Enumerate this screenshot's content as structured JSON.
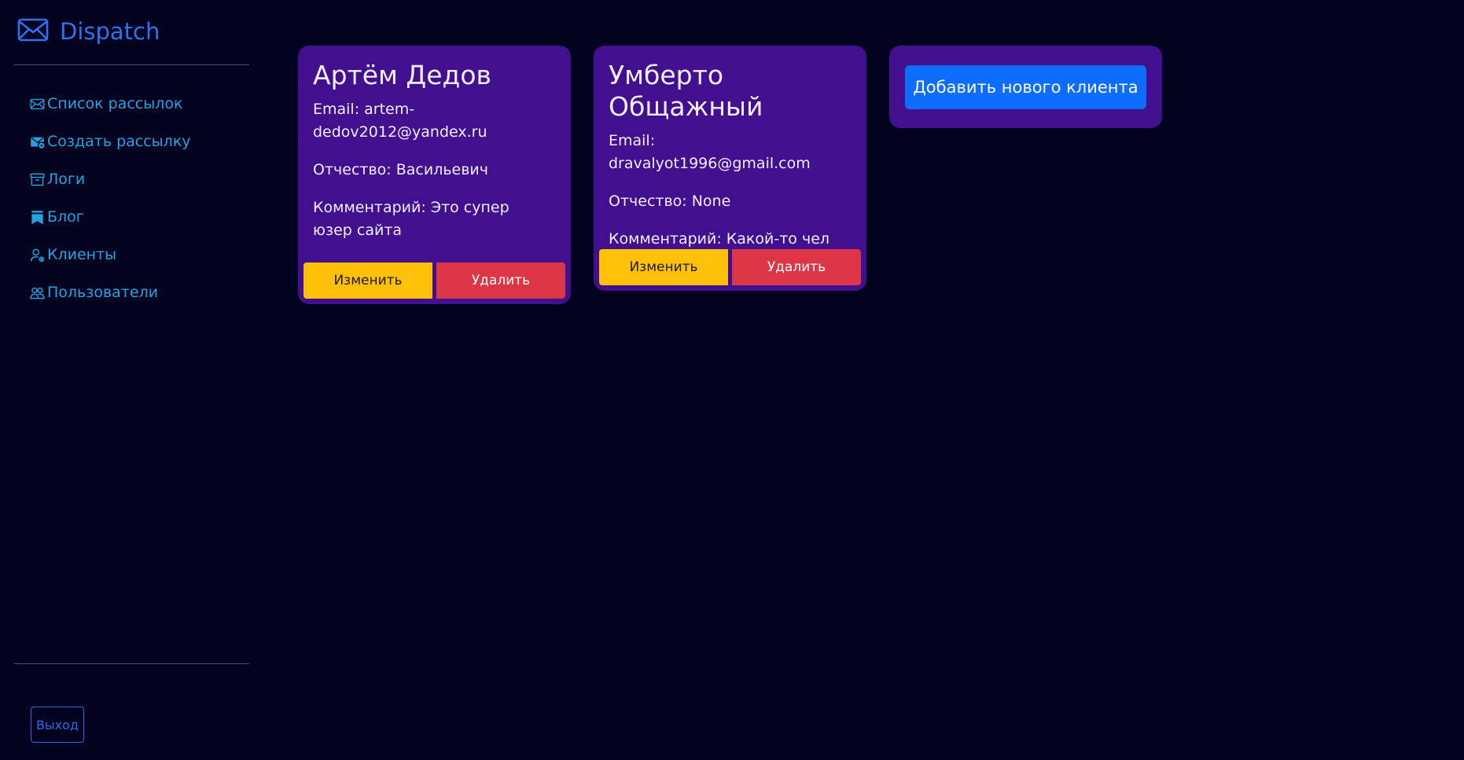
{
  "brand": {
    "name": "Dispatch",
    "icon": "envelope-icon",
    "color": "#2b73f0"
  },
  "sidebar": {
    "items": [
      {
        "label": "Список рассылок",
        "icon": "envelope-icon"
      },
      {
        "label": "Создать рассылку",
        "icon": "envelope-gear-icon"
      },
      {
        "label": "Логи",
        "icon": "archive-icon"
      },
      {
        "label": "Блог",
        "icon": "bookmarks-icon"
      },
      {
        "label": "Клиенты",
        "icon": "person-gear-icon"
      },
      {
        "label": "Пользователи",
        "icon": "people-icon"
      }
    ],
    "logout_label": "Выход"
  },
  "clients": [
    {
      "name": "Артём Дедов",
      "email_line": "Email: artem-dedov2012@yandex.ru",
      "patronymic_line": "Отчество: Васильевич",
      "comment_line": "Комментарий: Это супер юзер сайта",
      "edit_label": "Изменить",
      "delete_label": "Удалить"
    },
    {
      "name": "Умберто Общажный",
      "email_line": "Email: dravalyot1996@gmail.com",
      "patronymic_line": "Отчество: None",
      "comment_line": "Комментарий: Какой-то чел",
      "edit_label": "Изменить",
      "delete_label": "Удалить"
    }
  ],
  "add_client_label": "Добавить нового клиента",
  "colors": {
    "background": "#02021e",
    "card": "#42108f",
    "nav_link": "#24a3e2",
    "edit_button": "#ffc107",
    "delete_button": "#dc3545",
    "add_button": "#0d6efd"
  }
}
